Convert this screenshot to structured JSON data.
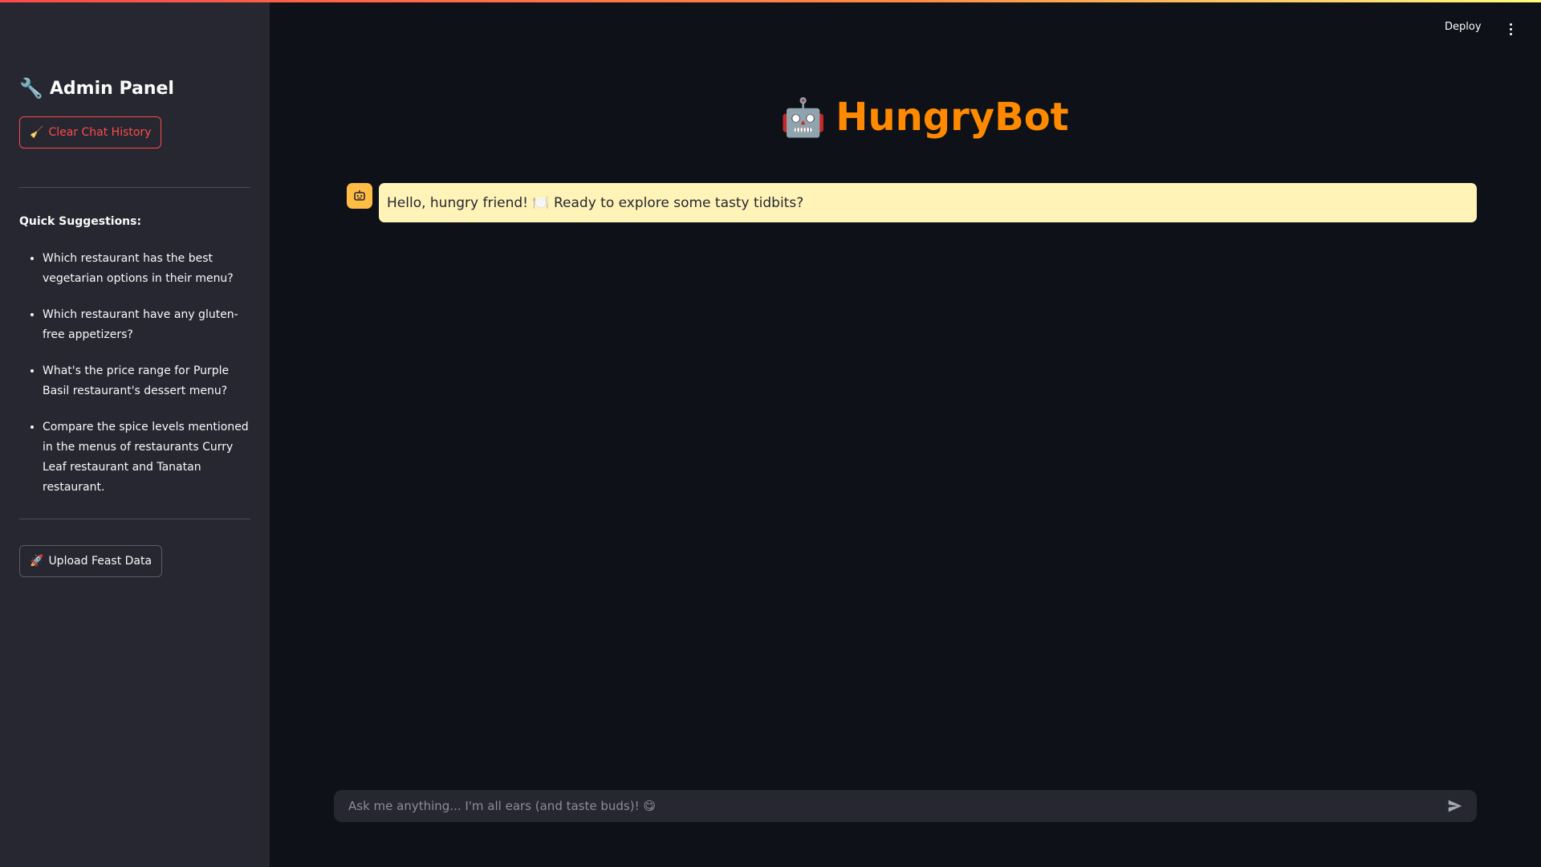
{
  "sidebar": {
    "title": "Admin Panel",
    "title_icon": "🔧",
    "clear_button": {
      "icon": "🧹",
      "label": "Clear Chat History"
    },
    "suggestions_heading": "Quick Suggestions:",
    "suggestions": [
      "Which restaurant has the best vegetarian options in their menu?",
      "Which restaurant have any gluten-free appetizers?",
      "What's the price range for Purple Basil restaurant's dessert menu?",
      "Compare the spice levels mentioned in the menus of restaurants Curry Leaf restaurant and Tanatan restaurant."
    ],
    "upload_button": {
      "icon": "🚀",
      "label": "Upload Feast Data"
    }
  },
  "header": {
    "deploy_label": "Deploy"
  },
  "main": {
    "title_icon": "🤖",
    "title": "HungryBot",
    "messages": [
      {
        "role": "assistant",
        "text": "Hello, hungry friend! 🍽️ Ready to explore some tasty tidbits?"
      }
    ],
    "input_placeholder": "Ask me anything... I'm all ears (and taste buds)! 😋"
  },
  "colors": {
    "accent": "#ff8a00",
    "danger": "#ff4b4b",
    "bubble": "#fff3b8",
    "avatar": "#ffbd45"
  }
}
